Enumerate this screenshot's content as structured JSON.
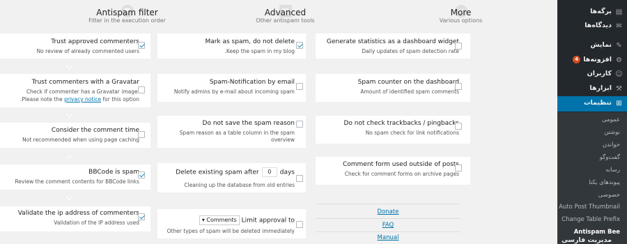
{
  "columns": [
    {
      "title": "Antispam filter",
      "subtitle": "Filter in the execution order",
      "icon": "filter-icon"
    },
    {
      "title": "Advanced",
      "subtitle": "Other antispam tools",
      "icon": "tools-icon"
    },
    {
      "title": "More",
      "subtitle": "Various options",
      "icon": "share-icon"
    }
  ],
  "filter_options": [
    {
      "title": "Trust approved commenters",
      "desc": "No review of already commented users",
      "checked": true
    },
    {
      "title": "Trust commenters with a Gravatar",
      "desc": "Check if commenter has a Gravatar image.",
      "desc2_prefix": ".Please note the ",
      "desc2_link": "privacy notice",
      "desc2_suffix": " for this option",
      "checked": false
    },
    {
      "title": "Consider the comment time",
      "desc": "Not recommended when using page caching",
      "checked": false
    },
    {
      "title": "BBCode is spam",
      "desc": "Review the comment contents for BBCode links",
      "checked": true
    },
    {
      "title": "Validate the ip address of commenters",
      "desc": "Validation of the IP address used",
      "checked": true
    }
  ],
  "advanced_options": [
    {
      "title": "Mark as spam, do not delete",
      "desc": ".Keep the spam in my blog",
      "checked": true
    },
    {
      "title": "Spam-Notification by email",
      "desc": "Notify admins by e-mail about incoming spam",
      "checked": false
    },
    {
      "title": "Do not save the spam reason",
      "desc": "Spam reason as a table column in the spam",
      "desc2": "overview",
      "checked": false
    },
    {
      "title_prefix": "Delete existing spam after",
      "days_value": "0",
      "title_suffix": "days",
      "desc": "Cleaning up the database from old entries",
      "checked": false
    },
    {
      "select_value": "Comments",
      "title_suffix": "Limit approval to",
      "desc": "Other types of spam will be deleted immediately",
      "checked": false
    }
  ],
  "more_options": [
    {
      "title": "Generate statistics as a dashboard widget",
      "desc": "Daily updates of spam detection rate",
      "checked": false
    },
    {
      "title": "Spam counter on the dashboard",
      "desc": "Amount of identified spam comments",
      "checked": false
    },
    {
      "title": "Do not check trackbacks / pingbacks",
      "desc": "No spam check for link notifications",
      "checked": false
    },
    {
      "title": "Comment form used outside of posts",
      "desc": "Check for comment forms on archive pages",
      "checked": false
    }
  ],
  "links": [
    "Donate",
    "FAQ",
    "Manual"
  ],
  "sidebar": {
    "items": [
      {
        "label": "برگه‌ها",
        "icon": "pages-icon",
        "glyph": "▤"
      },
      {
        "label": "دیدگاه‌ها",
        "icon": "comments-icon",
        "glyph": "✉"
      },
      {
        "label": "نمایش",
        "icon": "appearance-icon",
        "glyph": "✎"
      },
      {
        "label": "افزونه‌ها",
        "icon": "plugins-icon",
        "glyph": "⚙",
        "badge": "4"
      },
      {
        "label": "کاربران",
        "icon": "users-icon",
        "glyph": "☺"
      },
      {
        "label": "ابزارها",
        "icon": "tools-menu-icon",
        "glyph": "⚒"
      },
      {
        "label": "تنظیمات",
        "icon": "settings-icon",
        "glyph": "⊞",
        "active": true
      }
    ],
    "submenu": [
      {
        "label": "عمومی"
      },
      {
        "label": "نوشتن"
      },
      {
        "label": "خواندن"
      },
      {
        "label": "گفت‌وگو"
      },
      {
        "label": "رسانه"
      },
      {
        "label": "پیوندهای یکتا"
      },
      {
        "label": "خصوصی"
      },
      {
        "label": "Auto Post Thumbnail",
        "ltr": true
      },
      {
        "label": "Change Table Prefix",
        "ltr": true
      },
      {
        "label": "Antispam Bee",
        "ltr": true,
        "current": true
      }
    ],
    "next_item": "مدیریت فارسی"
  }
}
